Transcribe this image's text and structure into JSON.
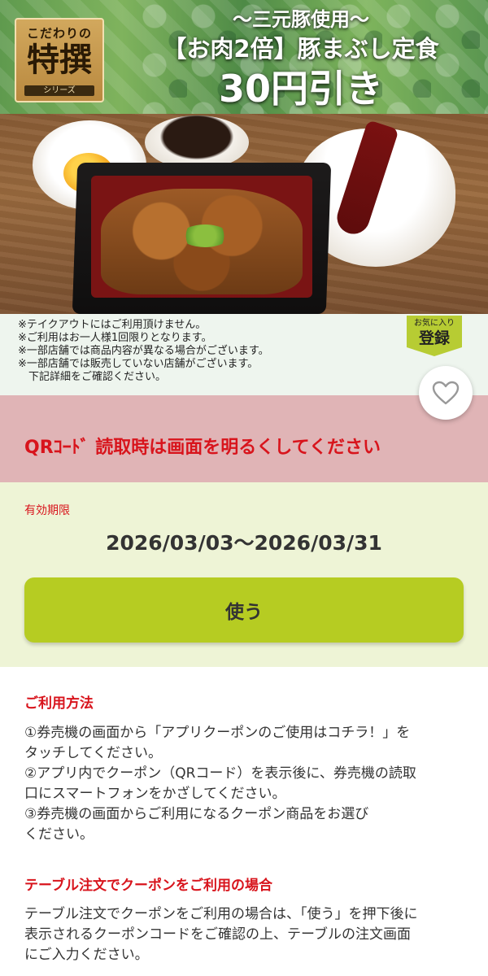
{
  "banner": {
    "badge_top": "こだわりの",
    "badge_main": "特撰",
    "badge_bottom": "シリーズ",
    "promo_line1": "〜三元豚使用〜",
    "promo_line2": "【お肉2倍】豚まぶし定食",
    "promo_line3": "30円引き"
  },
  "notes": [
    "※テイクアウトにはご利用頂けません。",
    "※ご利用はお一人様1回限りとなります。",
    "※一部店舗では商品内容が異なる場合がございます。",
    "※一部店舗では販売していない店舗がございます。",
    "　下記詳細をご確認ください。"
  ],
  "favorite": {
    "top": "お気に入り",
    "main": "登録",
    "icon": "heart-icon"
  },
  "qr_notice": "QRｺｰﾄﾞ 読取時は画面を明るくしてください",
  "validity": {
    "label": "有効期限",
    "range": "2026/03/03～2026/03/31"
  },
  "use_button": "使う",
  "usage": {
    "title": "ご利用方法",
    "lines": [
      "①券売機の画面から「アプリクーポンのご使用はコチラ！」を",
      "タッチしてください。",
      "②アプリ内でクーポン（QRコード）を表示後に、券売機の読取",
      "口にスマートフォンをかざしてください。",
      "③券売機の画面からご利用になるクーポン商品をお選び",
      "ください。"
    ]
  },
  "table_order": {
    "title": "テーブル注文でクーポンをご利用の場合",
    "lines": [
      "テーブル注文でクーポンをご利用の場合は、「使う」を押下後に",
      "表示されるクーポンコードをご確認の上、テーブルの注文画面",
      "にご入力ください。"
    ]
  },
  "colors": {
    "accent_red": "#d8141c",
    "button_green": "#b6cc22",
    "notice_pink": "#e0b4b6",
    "validity_bg": "#eef4d6"
  }
}
